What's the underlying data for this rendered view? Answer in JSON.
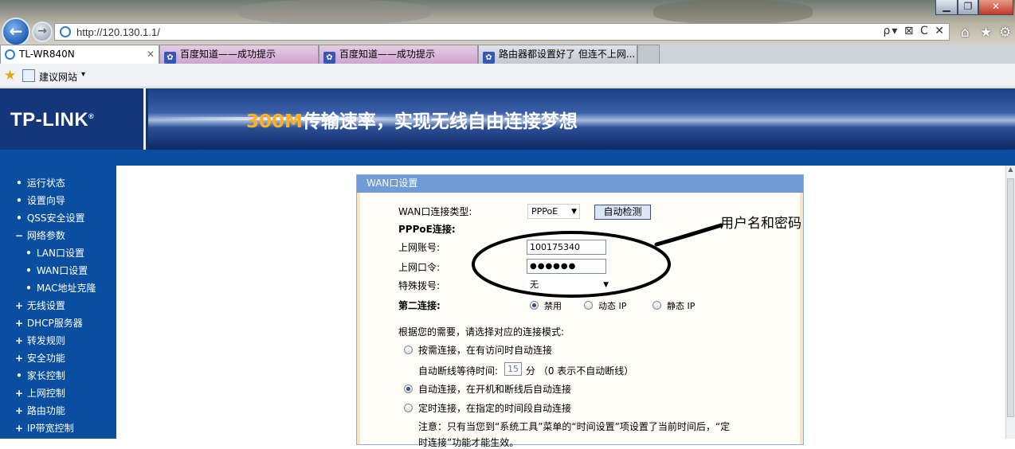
{
  "browser": {
    "address": "http://120.130.1.1/",
    "address_tools": "ρ▾ ⊠ C ✕",
    "tabs": [
      {
        "label": "TL-WR840N",
        "close": "✕"
      },
      {
        "label": "百度知道——成功提示"
      },
      {
        "label": "百度知道——成功提示"
      },
      {
        "label": "路由器都设置好了 但连不上网..."
      }
    ],
    "favorites_label": "建议网站",
    "window_buttons": {
      "minimize": "▁",
      "maximize": "❐",
      "close": "✕"
    },
    "icons": {
      "back": "←",
      "forward": "→",
      "home": "⌂",
      "star": "★",
      "gear": "⚙",
      "fav_star": "★",
      "caret": "▾"
    }
  },
  "router": {
    "logo": "TP-LINK",
    "logo_reg": "®",
    "slogan_highlight": "300M",
    "slogan_rest": "传输速率，实现无线自由连接梦想",
    "menu": [
      {
        "bullet": "•",
        "label": "运行状态"
      },
      {
        "bullet": "•",
        "label": "设置向导"
      },
      {
        "bullet": "•",
        "label": "QSS安全设置"
      },
      {
        "bullet": "−",
        "label": "网络参数"
      },
      {
        "bullet": "•",
        "label": "LAN口设置"
      },
      {
        "bullet": "•",
        "label": "WAN口设置"
      },
      {
        "bullet": "•",
        "label": "MAC地址克隆"
      },
      {
        "bullet": "+",
        "label": "无线设置"
      },
      {
        "bullet": "+",
        "label": "DHCP服务器"
      },
      {
        "bullet": "+",
        "label": "转发规则"
      },
      {
        "bullet": "+",
        "label": "安全功能"
      },
      {
        "bullet": "•",
        "label": "家长控制"
      },
      {
        "bullet": "+",
        "label": "上网控制"
      },
      {
        "bullet": "+",
        "label": "路由功能"
      },
      {
        "bullet": "+",
        "label": "IP带宽控制"
      }
    ],
    "panel": {
      "title": "WAN口设置",
      "conn_type_label": "WAN口连接类型:",
      "conn_type_value": "PPPoE",
      "detect_button": "自动检测",
      "pppoe_heading": "PPPoE连接:",
      "account_label": "上网账号:",
      "account_value": "100175340",
      "password_label": "上网口令:",
      "password_value": "●●●●●●",
      "dial_label": "特殊拨号:",
      "dial_value": "无",
      "second_label": "第二连接:",
      "second_options": [
        "禁用",
        "动态 IP",
        "静态 IP"
      ],
      "mode_prompt": "根据您的需要，请选择对应的连接模式:",
      "mode_on_demand": "按需连接，在有访问时自动连接",
      "idle_prefix": "自动断线等待时间:",
      "idle_value": "15",
      "idle_suffix": "分  （0 表示不自动断线）",
      "mode_auto": "自动连接，在开机和断线后自动连接",
      "mode_timed": "定时连接，在指定的时间段自动连接",
      "note_line1": "注意：只有当您到“系统工具”菜单的“时间设置”项设置了当前时间后，“定",
      "note_line2": "时连接”功能才能生效。"
    }
  },
  "annotation": {
    "text": "用户名和密码"
  }
}
